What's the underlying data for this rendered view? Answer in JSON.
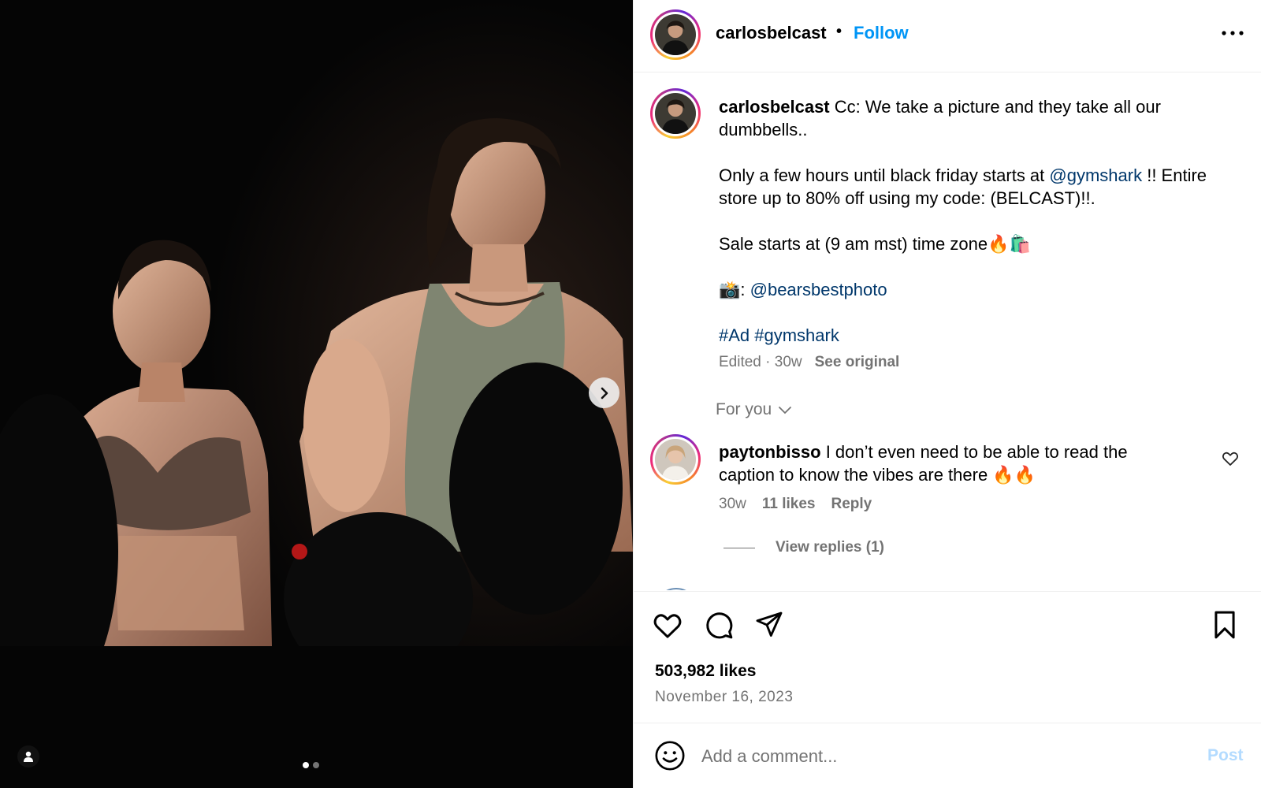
{
  "post": {
    "username": "carlosbelcast",
    "separator": "•",
    "follow_label": "Follow",
    "more_icon": "more-horizontal-icon"
  },
  "media": {
    "next_icon": "chevron-right-icon",
    "tag_icon": "user-tag-icon",
    "slide_count": 2,
    "active_slide": 1
  },
  "caption": {
    "username": "carlosbelcast",
    "line1": "Cc: We take a picture and they take all our dumbbells..",
    "p2_pre": "Only a few hours until black friday starts at ",
    "p2_mention": "@gymshark",
    "p2_post": " !! Entire store up to 80% off using my code: (BELCAST)!!.",
    "p3": "Sale starts at (9 am mst) time zone🔥🛍️",
    "p4_pre": "📸: ",
    "p4_mention": "@bearsbestphoto",
    "hashtags": "#Ad #gymshark",
    "meta": "Edited · 30w",
    "see_original": "See original"
  },
  "filter": {
    "label": "For you"
  },
  "comment1": {
    "username": "paytonbisso",
    "text": "I don’t even need to be able to read the caption to know the vibes are there 🔥🔥",
    "time": "30w",
    "likes": "11 likes",
    "reply": "Reply",
    "view_replies": "View replies (1)"
  },
  "actions": {
    "likes": "503,982 likes",
    "date": "November 16, 2023"
  },
  "composer": {
    "placeholder": "Add a comment...",
    "post_label": "Post"
  },
  "colors": {
    "follow": "#0095f6",
    "mention": "#00376b",
    "muted": "#737373",
    "post_disabled": "#b3dbff"
  }
}
